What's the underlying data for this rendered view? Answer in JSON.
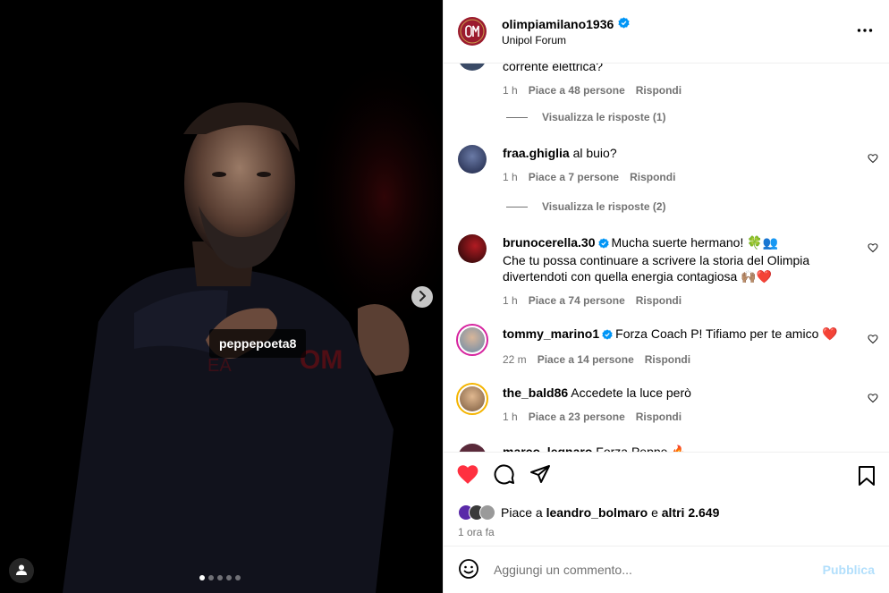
{
  "photo": {
    "tag_user": "peppepoeta8",
    "carousel_total": 5,
    "carousel_current": 1
  },
  "header": {
    "username": "olimpiamilano1936",
    "location": "Unipol Forum",
    "verified": true
  },
  "comments": [
    {
      "partial": true,
      "text": "corrente elettrica?",
      "time": "1 h",
      "likes": "Piace a 48 persone",
      "reply": "Rispondi",
      "replies_label": "Visualizza le risposte (1)"
    },
    {
      "username": "fraa.ghiglia",
      "text": "al buio?",
      "time": "1 h",
      "likes": "Piace a 7 persone",
      "reply": "Rispondi",
      "replies_label": "Visualizza le risposte (2)"
    },
    {
      "username": "brunocerella.30",
      "verified": true,
      "text": "Mucha suerte hermano! 🍀👥",
      "text2": "Che tu possa continuare a scrivere la storia del Olimpia divertendoti con quella energia contagiosa 🙌🏽❤️",
      "time": "1 h",
      "likes": "Piace a 74 persone",
      "reply": "Rispondi"
    },
    {
      "username": "tommy_marino1",
      "verified": true,
      "text": "Forza Coach P! Tifiamo per te amico ❤️",
      "time": "22 m",
      "likes": "Piace a 14 persone",
      "reply": "Rispondi"
    },
    {
      "username": "the_bald86",
      "text": "Accedete la luce però",
      "time": "1 h",
      "likes": "Piace a 23 persone",
      "reply": "Rispondi"
    },
    {
      "username": "marco_legnaro",
      "text": "Forza Peppe 🔥",
      "partial": true
    }
  ],
  "likes_bar": {
    "prefix": "Piace a",
    "user": "leandro_bolmaro",
    "middle": "e",
    "others": "altri 2.649"
  },
  "post_time": "1 ora fa",
  "composer": {
    "placeholder": "Aggiungi un commento...",
    "publish": "Pubblica"
  },
  "colors": {
    "like_red": "#ff3040",
    "verified_blue": "#0095f6",
    "brand": "#9b1b2e",
    "publish_disabled": "#b2dffc"
  },
  "icons": {
    "like": "heart-filled-icon",
    "comment": "speech-bubble-icon",
    "share": "paper-plane-icon",
    "save": "bookmark-icon",
    "emoji": "smiley-icon",
    "more": "ellipsis-icon",
    "next": "chevron-right-icon",
    "user": "person-icon"
  }
}
